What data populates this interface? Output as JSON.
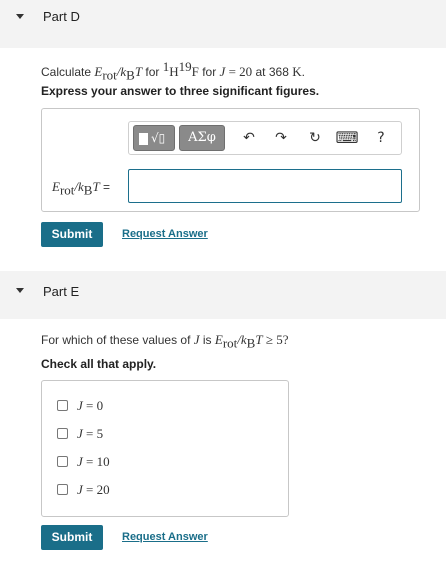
{
  "partD": {
    "title": "Part D",
    "prompt": {
      "calculate": "Calculate ",
      "E": "E",
      "rot": "rot",
      "slash_k": "/k",
      "B": "B",
      "T": "T",
      "for1": " for ",
      "sup1": "1",
      "H": "H",
      "sup19": "19",
      "F": "F",
      "for2": " for ",
      "J": "J",
      "eq20": " = 20",
      "at": " at 368 ",
      "K": "K",
      "period": "."
    },
    "instruction": "Express your answer to three significant figures.",
    "toolbar": {
      "template_symbol": "√▯",
      "greek_label": "ΑΣφ",
      "undo_symbol": "↶",
      "redo_symbol": "↷",
      "reset_symbol": "↻",
      "keyboard_symbol": "⌨",
      "help_symbol": "?"
    },
    "answer_label": {
      "E": "E",
      "rot": "rot",
      "slash_k": "/k",
      "B": "B",
      "T": "T",
      "eq": " ="
    },
    "answer_value": "",
    "submit_label": "Submit",
    "request_label": "Request Answer"
  },
  "partE": {
    "title": "Part E",
    "prompt": {
      "lead": "For which of these values of ",
      "J": "J",
      "is": " is ",
      "E": "E",
      "rot": "rot",
      "slash_k": "/k",
      "B": "B",
      "T": "T",
      "ge": " ≥ 5?"
    },
    "instruction": "Check all that apply.",
    "options": [
      {
        "J": "J",
        "rest": " = 0",
        "checked": false
      },
      {
        "J": "J",
        "rest": " = 5",
        "checked": false
      },
      {
        "J": "J",
        "rest": " = 10",
        "checked": false
      },
      {
        "J": "J",
        "rest": " = 20",
        "checked": false
      }
    ],
    "submit_label": "Submit",
    "request_label": "Request Answer"
  },
  "colors": {
    "accent": "#1a6e89",
    "header_bg": "#f3f3f3"
  }
}
